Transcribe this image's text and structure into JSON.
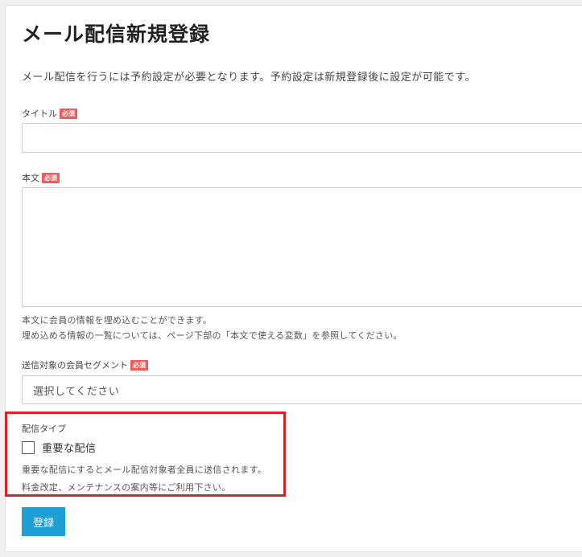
{
  "page": {
    "title": "メール配信新規登録",
    "intro": "メール配信を行うには予約設定が必要となります。予約設定は新規登録後に設定が可能です。"
  },
  "fields": {
    "title": {
      "label": "タイトル",
      "required_badge": "必須",
      "value": ""
    },
    "body": {
      "label": "本文",
      "required_badge": "必須",
      "value": "",
      "help_1": "本文に会員の情報を埋め込むことができます。",
      "help_2": "埋め込める情報の一覧については、ページ下部の「本文で使える変数」を参照してください。"
    },
    "segment": {
      "label": "送信対象の会員セグメント",
      "required_badge": "必須",
      "selected": "選択してください"
    },
    "delivery_type": {
      "label": "配信タイプ",
      "checkbox_label": "重要な配信",
      "checked": false,
      "help_1": "重要な配信にするとメール配信対象者全員に送信されます。",
      "help_2": "料金改定、メンテナンスの案内等にご利用下さい。"
    }
  },
  "actions": {
    "submit_label": "登録"
  },
  "colors": {
    "required_badge": "#ea5d5d",
    "primary_button": "#1e9fd6",
    "highlight_border": "#e01e26"
  }
}
